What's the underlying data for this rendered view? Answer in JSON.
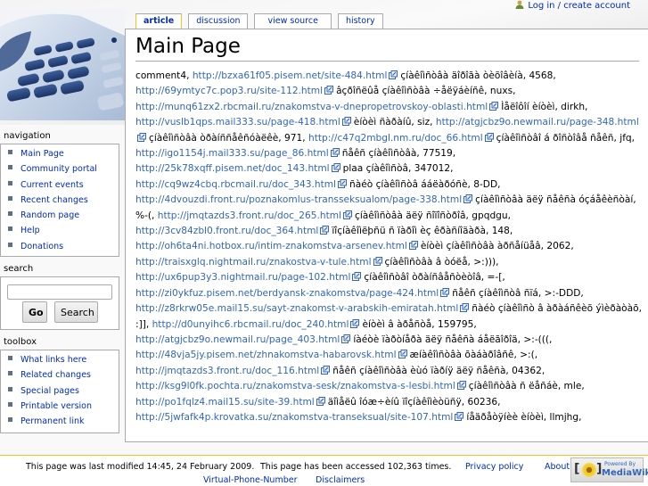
{
  "user": {
    "login_label": "Log in / create account"
  },
  "tabs": [
    {
      "label": "article",
      "selected": true
    },
    {
      "label": "discussion",
      "selected": false
    },
    {
      "label": "view source",
      "selected": false
    },
    {
      "label": "history",
      "selected": false
    }
  ],
  "page": {
    "title": "Main Page"
  },
  "content": {
    "prefix": "comment4,",
    "entries": [
      {
        "url": "http://bzxa61f05.pisem.net/site-484.html",
        "text": "çíàêîìñòâà äîðîãà òèõîâèíà, 4568,"
      },
      {
        "url": "http://69ymtyc7c.pop3.ru/site-112.html",
        "text": "âçðîñëûå çíàêîìñòâà ÷åëÿáèíñê, nuxs,"
      },
      {
        "url": "http://munq61zx2.rbcmail.ru/znakomstva-v-dnepropetrovskoy-oblasti.html",
        "text": "Ìåëîôîí èíòèì, dirkh,"
      },
      {
        "url": "http://vuslb1qps.mail333.su/page-418.html",
        "text": "èíòèì ñàðàíû, siz,"
      },
      {
        "url": "http://atgjcbz9o.newmail.ru/page-348.html",
        "text": "çíàêîìñòâà òðàíññåêñóàëêè, 971,"
      },
      {
        "url": "http://c47q2mbgl.nm.ru/doc_66.html",
        "text": "çíàêîìñòâî á ðîñòîâå ñåêñ, jfq,"
      },
      {
        "url": "http://igo1154j.mail333.su/page_86.html",
        "text": "ñåêñ çíàêîìñòâà, 77519,"
      },
      {
        "url": "http://25k78xqff.pisem.net/doc_143.html",
        "text": "plaa çíàêîìñòâ, 347012,"
      },
      {
        "url": "http://cq9wz4cbq.rbcmail.ru/doc_343.html",
        "text": "ñàéò çíàêîìñòâ ááëàðóñè, 8-DD,"
      },
      {
        "url": "http://4dvouzdi.front.ru/poznakomlus-transseksualom/page-338.html",
        "text": "çíàêîìñòâà äëÿ ñåêñà óçáåêèñòàí, %-(,"
      },
      {
        "url": "http://jmqtazds3.front.ru/doc_265.html",
        "text": "çíàêîìñòâà äëÿ ñîïîñòðîâ, gpqdgu,"
      },
      {
        "url": "http://3cv84zbl0.front.ru/doc_364.html",
        "text": "ïîçíàêîìëþñü ñ ïàðîì èç êðàñíîäàðà, 148,"
      },
      {
        "url": "http://oh6ta4ni.hotbox.ru/intim-znakomstva-arsenev.html",
        "text": "èíòèì çíàêîìñòâà àðñåíüåâ, 2062,"
      },
      {
        "url": "http://traisxglq.nightmail.ru/znakostva-v-tule.html",
        "text": "çíàêîìñòâà â òóëå, >:))),"
      },
      {
        "url": "http://ux6pup3y3.nightmail.ru/page-102.html",
        "text": "çíàêîìñòâî òðàíñâåñòèòîâ, =-[,"
      },
      {
        "url": "http://zi0ykfuz.pisem.net/berdyansk-znakomstva/page-424.html",
        "text": "ñåêñ çíàêîìñòâ ñïá, >:-DDD,"
      },
      {
        "url": "http://z8rkrw05e.mail15.su/sayt-znakomst-v-arabskih-emiratah.html",
        "text": "ñàéò çíàêîìñò â àðàáñêèõ ýìèðàòàõ, :]],"
      },
      {
        "url": "http://d0unyihc6.rbcmail.ru/doc_240.html",
        "text": "èíòèì â àðåñòå, 159795,"
      },
      {
        "url": "http://atgjcbz9o.newmail.ru/page_403.html",
        "text": "íàéòè ïàðòíåðà äëÿ ñåêñà áåëãîðîä, >:-(((,"
      },
      {
        "url": "http://48vja5jy.pisem.net/zhnakomstva-habarovsk.html",
        "text": "æíàêîìñòâà õàáàðîâñê, >:(,"
      },
      {
        "url": "http://jmqtazds3.front.ru/doc_116.html",
        "text": "ñåêñ çíàêîìñòâà èùó ïàðíÿ äëÿ ñåêñà, 04362,"
      },
      {
        "url": "http://ksg9l0fk.pochta.ru/znakomstva-sesk/znakomstva-s-lesbi.html",
        "text": "çíàêîìñòâà ñ ëåñáè, mle,"
      },
      {
        "url": "http://po1fqlz4.mail15.su/site-39.html",
        "text": "äîìåëû îóæ÷èíû ïîçíàêîìèòüñÿ, 60236,"
      },
      {
        "url": "http://5jwfafk4p.krovatka.su/znakomstva-transeksual/site-107.html",
        "text": "íåäðåòÿíèè èíòèì, llmjhg,"
      }
    ]
  },
  "sidebar": {
    "navigation": {
      "title": "navigation",
      "items": [
        "Main Page",
        "Community portal",
        "Current events",
        "Recent changes",
        "Random page",
        "Help",
        "Donations"
      ]
    },
    "search": {
      "title": "search",
      "input_value": "",
      "go_label": "Go",
      "search_label": "Search"
    },
    "toolbox": {
      "title": "toolbox",
      "items": [
        "What links here",
        "Related changes",
        "Special pages",
        "Printable version",
        "Permanent link"
      ]
    }
  },
  "footer": {
    "last_modified": "This page was last modified 14:45, 24 February 2009.",
    "accessed": "This page has been accessed 102,363 times.",
    "privacy": "Privacy policy",
    "about": "About",
    "virtual_phone": "Virtual-Phone-Number",
    "disclaimers": "Disclaimers",
    "badge_powered": "Powered By",
    "badge_name": "MediaWiki"
  },
  "colors": {
    "link": "#3366bb",
    "nav_link": "#002bb8",
    "selected_tab_border": "#fabd23",
    "footer_line": "#fabd23"
  }
}
